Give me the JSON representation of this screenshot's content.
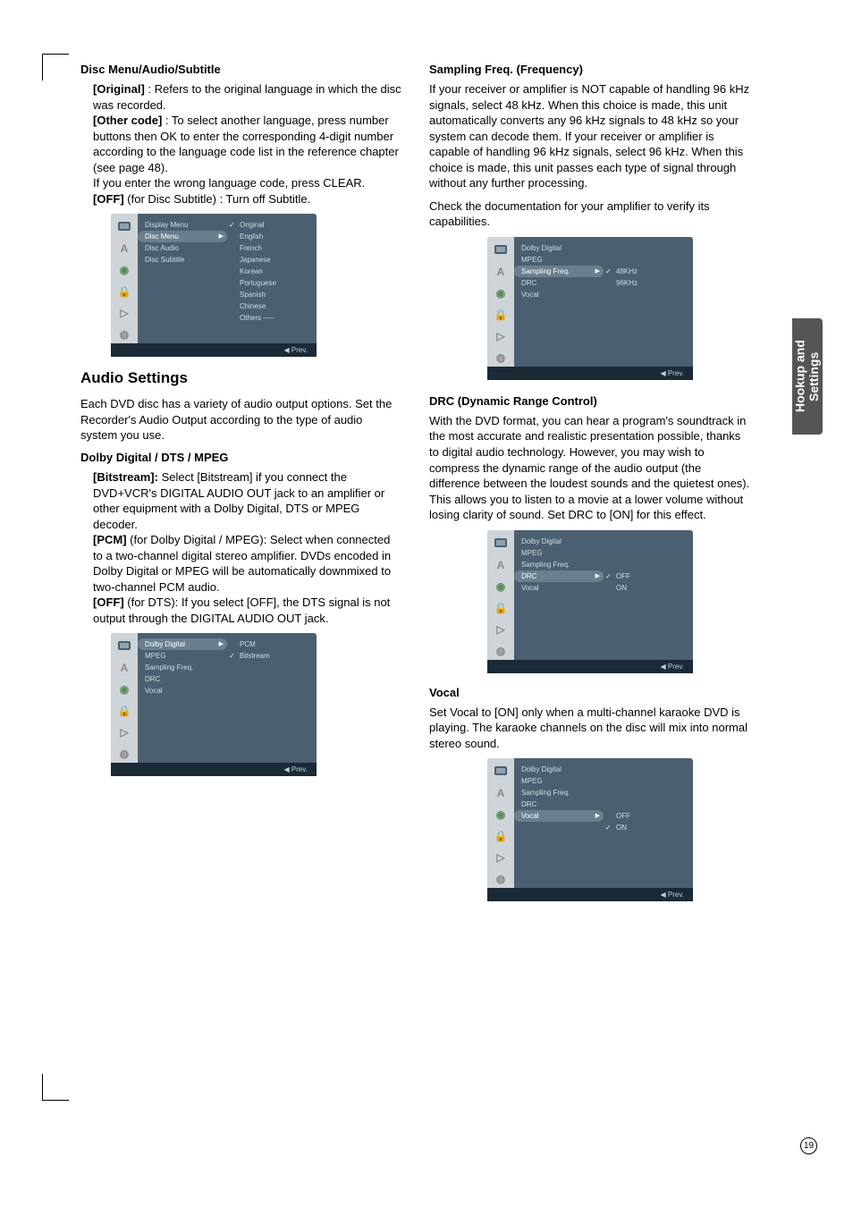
{
  "side_tab": "Hookup and Settings",
  "page_number": "19",
  "left": {
    "disc_menu": {
      "title": "Disc Menu/Audio/Subtitle",
      "original_label": "[Original]",
      "original_text": " : Refers to the original language in which the disc was recorded.",
      "other_label": "[Other code]",
      "other_text": " : To select another language, press number buttons then OK to enter the corresponding 4-digit number according to the language code list in the reference chapter (see page 48).",
      "wrong_code": "If you enter the wrong language code, press CLEAR.",
      "off_label": "[OFF]",
      "off_text": " (for Disc Subtitle) : Turn off Subtitle."
    },
    "menu1": {
      "left_items": [
        "Display Menu",
        "Disc Menu",
        "Disc Audio",
        "Disc Subtitle"
      ],
      "right_items": [
        "Original",
        "English",
        "French",
        "Japanese",
        "Korean",
        "Portuguese",
        "Spanish",
        "Chinese",
        "Others -----"
      ],
      "footer": "◀ Prev."
    },
    "audio": {
      "title": "Audio Settings",
      "intro": "Each DVD disc has a variety of audio output options. Set the Recorder's Audio Output according to the type of audio system you use.",
      "dolby_title": "Dolby Digital / DTS / MPEG",
      "bitstream_label": "[Bitstream]:",
      "bitstream_text": " Select [Bitstream] if you connect the DVD+VCR's DIGITAL AUDIO OUT jack to an amplifier or other equipment with a Dolby Digital, DTS or MPEG decoder.",
      "pcm_label": "[PCM]",
      "pcm_text": " (for Dolby Digital / MPEG): Select when connected to a two-channel digital stereo amplifier. DVDs encoded in Dolby Digital or MPEG will be automatically downmixed to two-channel PCM audio.",
      "off_label": "[OFF]",
      "off_text": " (for DTS): If you select [OFF], the DTS signal is not output through the DIGITAL AUDIO OUT jack."
    },
    "menu2": {
      "left_items": [
        "Dolby Digital",
        "MPEG",
        "Sampling Freq.",
        "DRC",
        "Vocal"
      ],
      "right_items": [
        "PCM",
        "Bitstream"
      ],
      "footer": "◀ Prev."
    }
  },
  "right": {
    "sampling": {
      "title": "Sampling Freq. (Frequency)",
      "text": "If your receiver or amplifier is NOT capable of handling 96 kHz signals, select 48 kHz. When this choice is made, this unit automatically converts any 96 kHz signals to 48 kHz so your system can decode them. If your receiver or amplifier is capable of handling 96 kHz signals, select 96 kHz. When this choice is made, this unit passes each type of signal through without any further processing.",
      "check": "Check the documentation for your amplifier to verify its capabilities."
    },
    "menu3": {
      "left_items": [
        "Dolby Digital",
        "MPEG",
        "Sampling Freq.",
        "DRC",
        "Vocal"
      ],
      "right_items": [
        "48KHz",
        "96KHz"
      ],
      "footer": "◀ Prev."
    },
    "drc": {
      "title": "DRC (Dynamic Range Control)",
      "text": "With the DVD format, you can hear a program's soundtrack in the most accurate and realistic presentation possible, thanks to digital audio technology. However, you may wish to compress the dynamic range of the audio output (the difference between the loudest sounds and the quietest ones). This allows you to listen to a movie at a lower volume without losing clarity of sound. Set DRC to [ON] for this effect."
    },
    "menu4": {
      "left_items": [
        "Dolby Digital",
        "MPEG",
        "Sampling Freq.",
        "DRC",
        "Vocal"
      ],
      "right_items": [
        "OFF",
        "ON"
      ],
      "footer": "◀ Prev."
    },
    "vocal": {
      "title": "Vocal",
      "text": "Set Vocal to [ON] only when a multi-channel karaoke DVD is playing. The karaoke channels on the disc will mix into normal stereo sound."
    },
    "menu5": {
      "left_items": [
        "Dolby Digital",
        "MPEG",
        "Sampling Freq.",
        "DRC",
        "Vocal"
      ],
      "right_items": [
        "OFF",
        "ON"
      ],
      "footer": "◀ Prev."
    }
  },
  "icons": [
    "▣",
    "A",
    "◉",
    "🔒",
    "▷",
    "◍"
  ]
}
